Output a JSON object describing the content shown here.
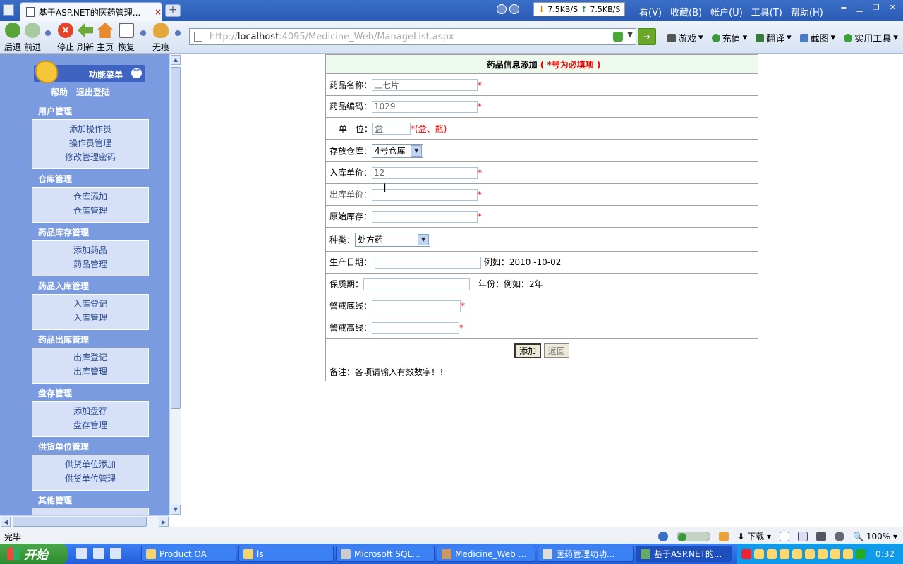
{
  "browser": {
    "tab_title": "基于ASP.NET的医药管理...",
    "tab_close": "×",
    "tab_new": "+",
    "net_down": "7.5KB/S",
    "net_up": "7.5KB/S",
    "menu": [
      "看(V)",
      "收藏(B)",
      "帐户(U)",
      "工具(T)",
      "帮助(H)"
    ],
    "toolbar": {
      "back": "后退",
      "forward": "前进",
      "stop": "停止",
      "refresh": "刷新",
      "home": "主页",
      "restore": "恢复",
      "incognito": "无痕"
    },
    "address": {
      "prefix": "http://",
      "host": "localhost",
      "path": ":4095/Medicine_Web/ManageList.aspx"
    },
    "right_tools": [
      "游戏",
      "充值",
      "翻译",
      "截图",
      "实用工具"
    ]
  },
  "sidebar": {
    "title": "功能菜单",
    "links": [
      "帮助",
      "退出登陆"
    ],
    "sections": [
      {
        "title": "用户管理",
        "items": [
          "添加操作员",
          "操作员管理",
          "修改管理密码"
        ]
      },
      {
        "title": "仓库管理",
        "items": [
          "仓库添加",
          "仓库管理"
        ]
      },
      {
        "title": "药品库存管理",
        "items": [
          "添加药品",
          "药品管理"
        ]
      },
      {
        "title": "药品入库管理",
        "items": [
          "入库登记",
          "入库管理"
        ]
      },
      {
        "title": "药品出库管理",
        "items": [
          "出库登记",
          "出库管理"
        ]
      },
      {
        "title": "盘存管理",
        "items": [
          "添加盘存",
          "盘存管理"
        ]
      },
      {
        "title": "供货单位管理",
        "items": [
          "供货单位添加",
          "供货单位管理"
        ]
      },
      {
        "title": "其他管理",
        "items": []
      }
    ]
  },
  "form": {
    "title": "药品信息添加",
    "required_note": "( *号为必填项 )",
    "required_mark": "*",
    "name_label": "药品名称：",
    "name_value": "三七片",
    "code_label": "药品编码：",
    "code_value": "1029",
    "unit_label": "单　位：",
    "unit_value": "盒",
    "unit_hint": "*(盒、瓶)",
    "warehouse_label": "存放仓库：",
    "warehouse_value": "4号仓库",
    "in_price_label": "入库单价：",
    "in_price_value": "12",
    "out_price_label": "出库单价：",
    "out_price_value": "",
    "stock_label": "原始库存：",
    "stock_value": "",
    "category_label": "种类：",
    "category_value": "处方药",
    "prod_date_label": "生产日期：",
    "prod_date_value": "",
    "prod_date_hint": "例如：2010 -10-02",
    "shelf_label": "保质期：",
    "shelf_value": "",
    "shelf_hint": "年份：例如：2年",
    "low_label": "警戒底线：",
    "low_value": "",
    "high_label": "警戒高线：",
    "high_value": "",
    "add_button": "添加",
    "back_button": "返回",
    "remark": "备注：各项请输入有效数字！！"
  },
  "status": {
    "text": "完毕",
    "download": "下载",
    "zoom": "100%"
  },
  "taskbar": {
    "start": "开始",
    "tasks": [
      "Product.OA",
      "ls",
      "Microsoft SQL...",
      "Medicine_Web ...",
      "医药管理功功...",
      "基于ASP.NET的..."
    ],
    "clock": "0:32"
  },
  "colors": {
    "sidebar_bg": "#7b9be0",
    "form_header_bg": "#eefaee",
    "required": "#ee0000"
  }
}
